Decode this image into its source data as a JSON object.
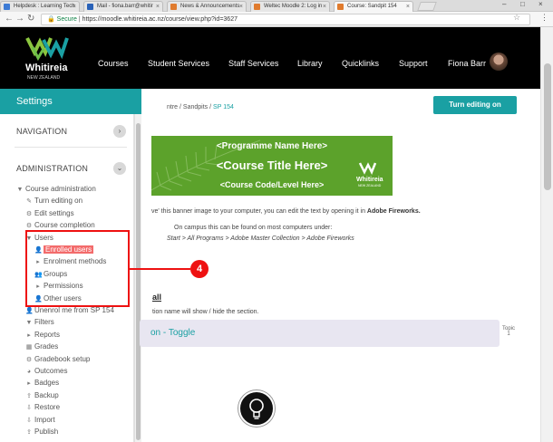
{
  "browser": {
    "tabs": [
      {
        "label": "Helpdesk : Learning Tech",
        "color": "#3d7bd5"
      },
      {
        "label": "Mail - fiona.barr@whitir",
        "color": "#2a62b8"
      },
      {
        "label": "News & Announcements",
        "color": "#e07b2e"
      },
      {
        "label": "Weltec Moodle 2: Log in",
        "color": "#e07b2e"
      },
      {
        "label": "Course: Sandpit 154",
        "color": "#e07b2e"
      }
    ],
    "address": {
      "secure_label": "Secure",
      "url": "https://moodle.whitireia.ac.nz/course/view.php?id=3627"
    }
  },
  "topnav": {
    "logo_text": "Whitireia",
    "logo_sub": "NEW ZEALAND",
    "items": [
      "Courses",
      "Student Services",
      "Staff Services",
      "Library",
      "Quicklinks",
      "Support"
    ],
    "user_name": "Fiona Barr"
  },
  "settings": {
    "title": "Settings"
  },
  "sidebar": {
    "navigation_label": "NAVIGATION",
    "administration_label": "ADMINISTRATION",
    "tree": [
      {
        "label": "Course administration",
        "icon": "▼",
        "indent": 0
      },
      {
        "label": "Turn editing on",
        "icon": "✎",
        "indent": 1
      },
      {
        "label": "Edit settings",
        "icon": "⚙",
        "indent": 1
      },
      {
        "label": "Course completion",
        "icon": "⚙",
        "indent": 1
      },
      {
        "label": "Users",
        "icon": "▼",
        "indent": 1
      },
      {
        "label": "Enrolled users",
        "icon": "👤",
        "indent": 2,
        "highlight": true
      },
      {
        "label": "Enrolment methods",
        "icon": "▸",
        "indent": 2
      },
      {
        "label": "Groups",
        "icon": "👥",
        "indent": 2
      },
      {
        "label": "Permissions",
        "icon": "▸",
        "indent": 2
      },
      {
        "label": "Other users",
        "icon": "👤",
        "indent": 2
      },
      {
        "label": "Unenrol me from SP 154",
        "icon": "👤",
        "indent": 1
      },
      {
        "label": "Filters",
        "icon": "▼",
        "indent": 1
      },
      {
        "label": "Reports",
        "icon": "▸",
        "indent": 1
      },
      {
        "label": "Grades",
        "icon": "▦",
        "indent": 1
      },
      {
        "label": "Gradebook setup",
        "icon": "⚙",
        "indent": 1
      },
      {
        "label": "Outcomes",
        "icon": "◕",
        "indent": 1
      },
      {
        "label": "Badges",
        "icon": "▸",
        "indent": 1
      },
      {
        "label": "Backup",
        "icon": "⇪",
        "indent": 1
      },
      {
        "label": "Restore",
        "icon": "⇩",
        "indent": 1
      },
      {
        "label": "Import",
        "icon": "⇩",
        "indent": 1
      },
      {
        "label": "Publish",
        "icon": "⇪",
        "indent": 1
      }
    ]
  },
  "main": {
    "breadcrumb_1": "ntre",
    "breadcrumb_sep": "/",
    "breadcrumb_2": "Sandpits",
    "breadcrumb_3": "SP 154",
    "edit_button": "Turn editing on",
    "banner": {
      "line1": "<Programme Name Here>",
      "line2": "<Course Title Here>",
      "line3": "<Course Code/Level Here>",
      "logo_text": "Whitireia",
      "logo_sub": "NEW ZEALAND"
    },
    "para1_a": "ve' this banner image to your computer, you can edit the text by opening it in ",
    "para1_b": "Adobe Fireworks.",
    "para2": "On campus this can be found on most computers under:",
    "para3": "Start > All Programs > Adobe Master Collection > Adobe Fireworks",
    "section_link": "all",
    "section_note": "tion name will show / hide the section.",
    "toggle_label": "on - Toggle",
    "topic_label": "Topic",
    "topic_num": "1"
  },
  "annotation": {
    "number": "4",
    "color": "#ee1111"
  }
}
